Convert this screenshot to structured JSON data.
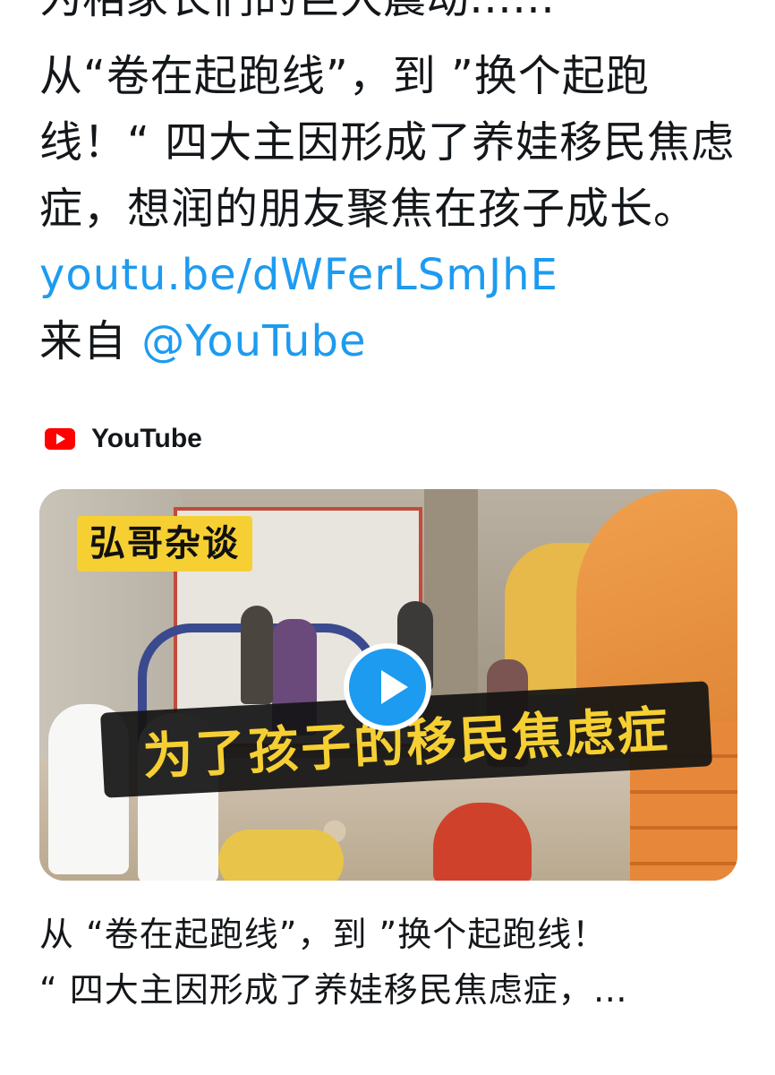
{
  "tweet": {
    "cut_line": "为相家长们的巨大震动……",
    "text_main": "从“卷在起跑线”，到 ”换个起跑线！“ 四大主因形成了养娃移民焦虑症，想润的朋友聚焦在孩子成长。",
    "link": "youtu.be/dWFerLSmJhE",
    "from_label": "来自",
    "mention": "@YouTube"
  },
  "card": {
    "source": "YouTube",
    "thumbnail_tag": "弘哥杂谈",
    "thumbnail_banner": "为了孩子的移民焦虑症",
    "title_line1": "从 “卷在起跑线”，到 ”换个起跑线！",
    "title_line2": "“ 四大主因形成了养娃移民焦虑症，…"
  },
  "colors": {
    "link": "#1d9bf0",
    "banner_text": "#f6d033",
    "youtube_red": "#ff0000"
  },
  "icons": {
    "source_icon": "youtube-logo-icon",
    "play_icon": "play-icon"
  }
}
